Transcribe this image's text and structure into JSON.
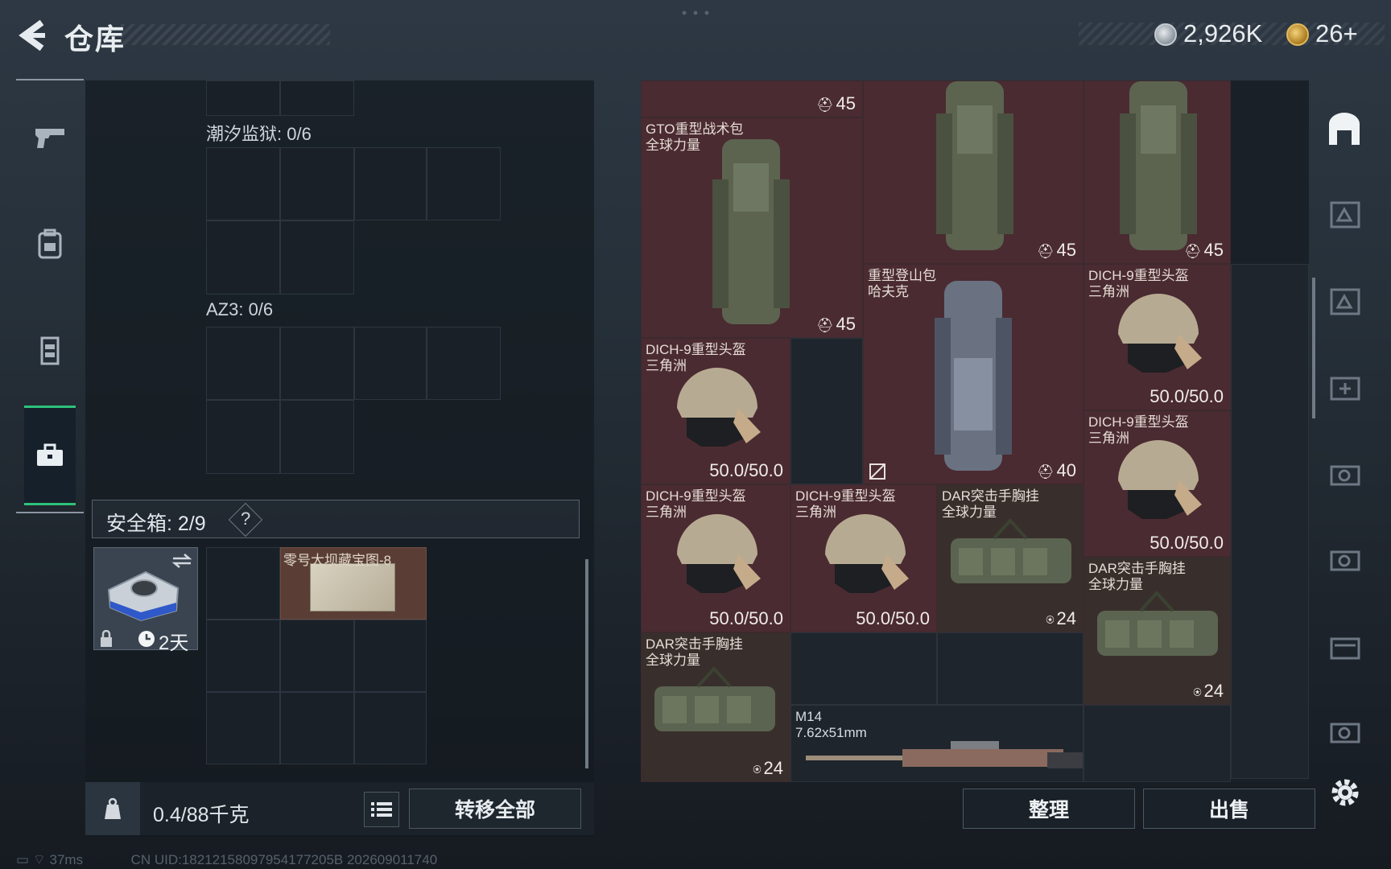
{
  "header": {
    "title": "仓库",
    "currency_silver": "2,926K",
    "currency_gold": "26+"
  },
  "nav": {
    "items": [
      {
        "icon": "pistol-icon"
      },
      {
        "icon": "backpack-icon"
      },
      {
        "icon": "vest-icon"
      },
      {
        "icon": "briefcase-icon",
        "selected": true
      }
    ]
  },
  "left": {
    "section1_label": "潮汐监狱: 0/6",
    "section2_label": "AZ3: 0/6",
    "case_label": "安全箱:  2/9",
    "case_help": "?",
    "case_item_timer": "2天",
    "map_item_label": "零号大坝藏宝图-8",
    "weight": "0.4/88千克",
    "transfer_all": "转移全部"
  },
  "inventory": {
    "items": [
      {
        "name1": "",
        "name2": "",
        "value": "45",
        "value_icon": "backpack-icon"
      },
      {
        "name1": "GTO重型战术包",
        "name2": "全球力量",
        "value": "45",
        "value_icon": "backpack-icon"
      },
      {
        "name1": "",
        "name2": "",
        "value": "45",
        "value_icon": "backpack-icon"
      },
      {
        "name1": "",
        "name2": "",
        "value": "45",
        "value_icon": "backpack-icon"
      },
      {
        "name1": "重型登山包",
        "name2": "哈夫克",
        "value": "40",
        "value_icon": "backpack-icon"
      },
      {
        "name1": "DICH-9重型头盔",
        "name2": "三角洲",
        "value": "50.0/50.0"
      },
      {
        "name1": "DICH-9重型头盔",
        "name2": "三角洲",
        "value": "50.0/50.0"
      },
      {
        "name1": "DICH-9重型头盔",
        "name2": "三角洲",
        "value": "50.0/50.0"
      },
      {
        "name1": "DICH-9重型头盔",
        "name2": "三角洲",
        "value": "50.0/50.0"
      },
      {
        "name1": "DICH-9重型头盔",
        "name2": "三角洲",
        "value": "50.0/50.0"
      },
      {
        "name1": "DAR突击手胸挂",
        "name2": "全球力量",
        "value": "24",
        "value_icon": "vest-icon"
      },
      {
        "name1": "DAR突击手胸挂",
        "name2": "全球力量",
        "value": "24",
        "value_icon": "vest-icon"
      },
      {
        "name1": "DAR突击手胸挂",
        "name2": "全球力量",
        "value": "24",
        "value_icon": "vest-icon"
      },
      {
        "name1": "M14",
        "name2": "7.62x51mm",
        "value": ""
      }
    ],
    "sort_label": "整理",
    "sell_label": "出售"
  },
  "status": {
    "ping": "37ms",
    "uid": "CN UID:18212158097954177205B 202609011740"
  },
  "colors": {
    "accent_green": "#2ec27a",
    "item_red": "#4a2b31",
    "item_brown": "#382f2c"
  }
}
